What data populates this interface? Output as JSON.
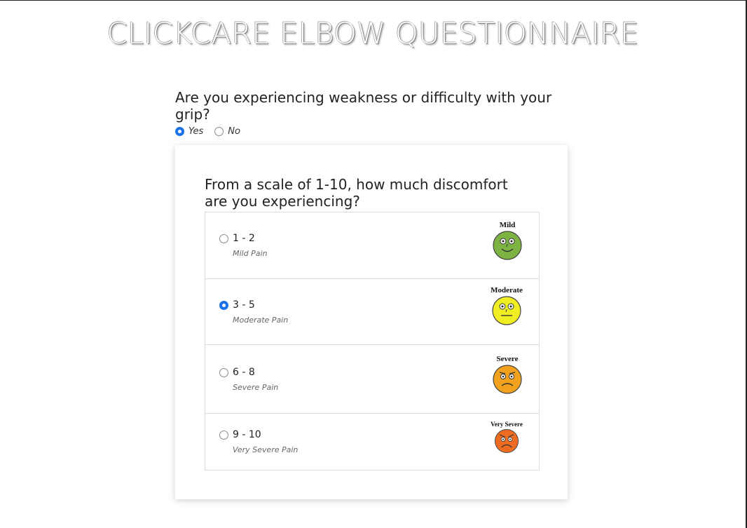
{
  "header": {
    "title": "CLICKCARE ELBOW QUESTIONNAIRE"
  },
  "question1": {
    "text": "Are you experiencing weakness or difficulty with your grip?",
    "options": [
      {
        "label": "Yes",
        "checked": true
      },
      {
        "label": "No",
        "checked": false
      }
    ]
  },
  "question2": {
    "text": "From a scale of 1-10, how much discomfort are you experiencing?",
    "options": [
      {
        "range": "1 - 2",
        "desc": "Mild Pain",
        "face_label": "Mild",
        "face_color": "#7cb342",
        "checked": false
      },
      {
        "range": "3 - 5",
        "desc": "Moderate Pain",
        "face_label": "Moderate",
        "face_color": "#eeee22",
        "checked": true
      },
      {
        "range": "6 - 8",
        "desc": "Severe Pain",
        "face_label": "Severe",
        "face_color": "#f2a11e",
        "checked": false
      },
      {
        "range": "9 - 10",
        "desc": "Very Severe Pain",
        "face_label": "Very Severe",
        "face_color": "#ee6b22",
        "checked": false
      }
    ]
  },
  "colors": {
    "accent": "#1a73e8"
  }
}
